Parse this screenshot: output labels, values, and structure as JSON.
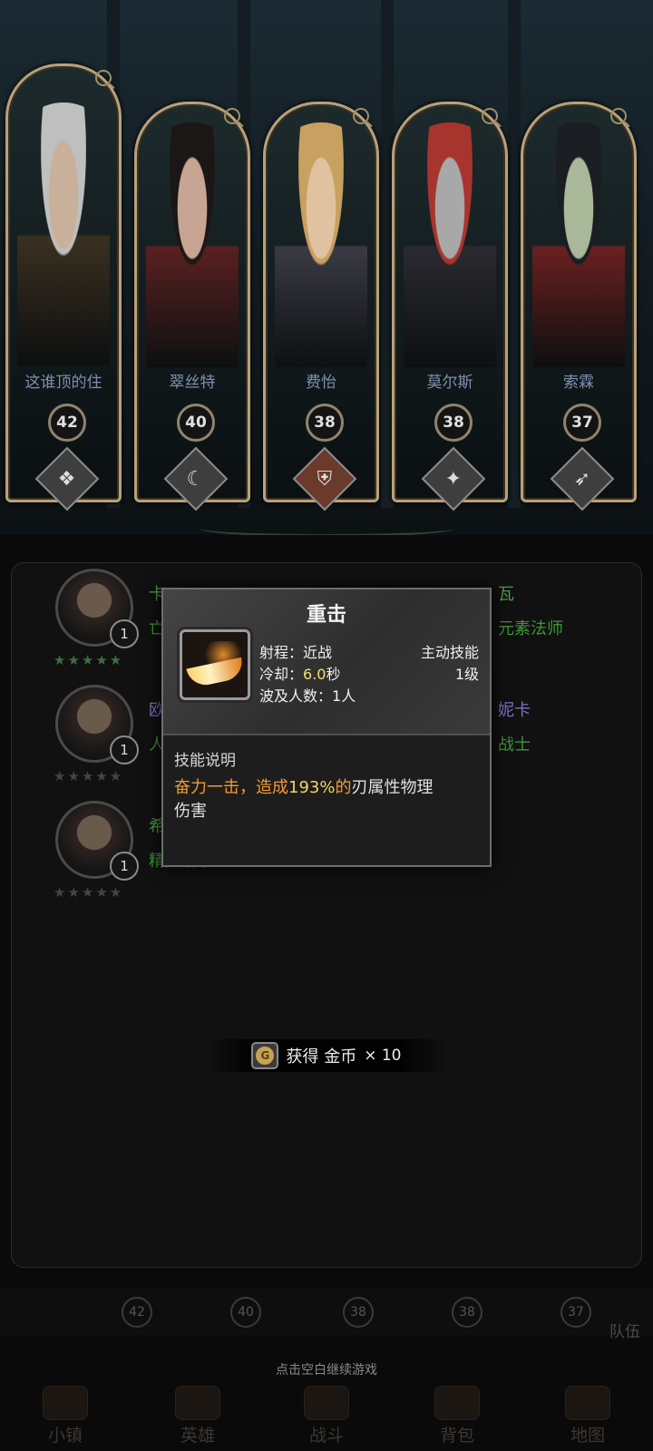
{
  "heroes": [
    {
      "name": "这谁顶的住",
      "level": "42",
      "class_icon": "book-icon",
      "skin": "#c9b09a",
      "hair": "#bfbfbf",
      "armor": "#3a3020"
    },
    {
      "name": "翠丝特",
      "level": "40",
      "class_icon": "scythe-icon",
      "skin": "#c8a592",
      "hair": "#1b1716",
      "armor": "#5a2020"
    },
    {
      "name": "费怡",
      "level": "38",
      "class_icon": "shield-icon",
      "skin": "#e0c2a0",
      "hair": "#c8a060",
      "armor": "#3a3a44"
    },
    {
      "name": "莫尔斯",
      "level": "38",
      "class_icon": "compass-icon",
      "skin": "#a8a8a8",
      "hair": "#a8342e",
      "armor": "#2a2a30"
    },
    {
      "name": "索霖",
      "level": "37",
      "class_icon": "bow-icon",
      "skin": "#a8b898",
      "hair": "#1a1d22",
      "armor": "#6a2020"
    }
  ],
  "team_list": [
    {
      "name": "卡",
      "role": "亡灵",
      "level": "1",
      "stars": "★★★★★",
      "right_name": "瓦",
      "right_role": "元素法师"
    },
    {
      "name": "欧",
      "role": "人类",
      "level": "1",
      "stars": "★★★★★",
      "right_name": "妮卡",
      "right_role": "战士"
    },
    {
      "name": "希",
      "role": "精灵射手",
      "level": "1",
      "stars": "★★★★★",
      "right_name": "",
      "right_role": ""
    }
  ],
  "skill_popup": {
    "title": "重击",
    "range_label": "射程：",
    "range_value": "近战",
    "type": "主动技能",
    "cooldown_label": "冷却：",
    "cooldown_value": "6.0",
    "cooldown_unit": "秒",
    "level": "1级",
    "targets_label": "波及人数：",
    "targets_value": "1人",
    "desc_title": "技能说明",
    "desc_part1": "奋力一击，造成",
    "desc_percent": "193%",
    "desc_part2": "的",
    "desc_part3": "刃属性物理伤害"
  },
  "reward": {
    "label": "获得 金币",
    "count": "× 10",
    "coin_letter": "G"
  },
  "bottom_levels": [
    "42",
    "40",
    "38",
    "38",
    "37"
  ],
  "team_label": "队伍",
  "continue_hint": "点击空白继续游戏",
  "nav": [
    {
      "label": "小镇",
      "icon": "town-icon"
    },
    {
      "label": "英雄",
      "icon": "hero-icon"
    },
    {
      "label": "战斗",
      "icon": "battle-icon"
    },
    {
      "label": "背包",
      "icon": "bag-icon"
    },
    {
      "label": "地图",
      "icon": "map-icon"
    }
  ],
  "colors": {
    "card_border": "#b8a17a",
    "green_text": "#4fa14a",
    "purple_text": "#7f71c9",
    "highlight_orange": "#f09a3a",
    "highlight_gold": "#f4d36a"
  }
}
